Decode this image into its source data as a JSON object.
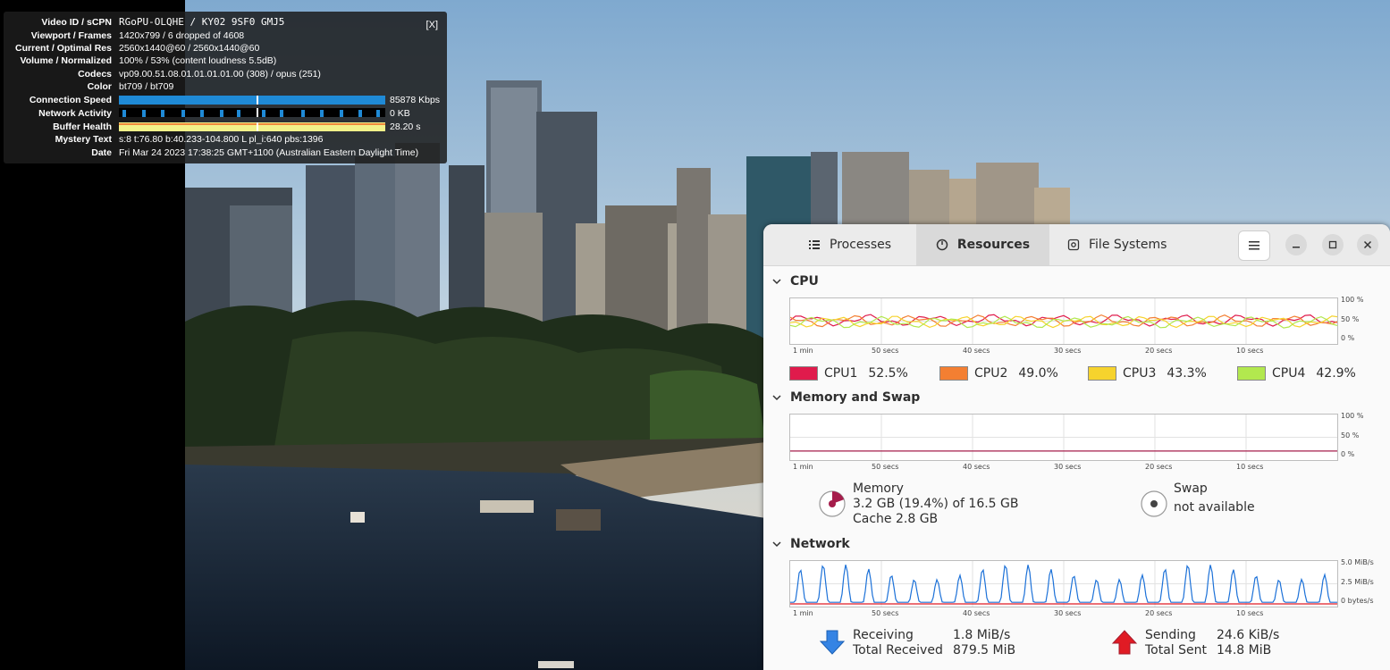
{
  "stats": {
    "close": "[X]",
    "rows": [
      {
        "label": "Video ID / sCPN",
        "value": "RGoPU-OLQHE / KY02 9SF0 GMJ5"
      },
      {
        "label": "Viewport / Frames",
        "value": "1420x799 / 6 dropped of 4608"
      },
      {
        "label": "Current / Optimal Res",
        "value": "2560x1440@60 / 2560x1440@60"
      },
      {
        "label": "Volume / Normalized",
        "value": "100% / 53% (content loudness 5.5dB)"
      },
      {
        "label": "Codecs",
        "value": "vp09.00.51.08.01.01.01.01.00 (308) / opus (251)"
      },
      {
        "label": "Color",
        "value": "bt709 / bt709"
      },
      {
        "label": "Connection Speed",
        "value": "85878 Kbps"
      },
      {
        "label": "Network Activity",
        "value": "0 KB"
      },
      {
        "label": "Buffer Health",
        "value": "28.20 s"
      },
      {
        "label": "Mystery Text",
        "value": "s:8 t:76.80 b:40.233-104.800 L pl_i:640 pbs:1396"
      },
      {
        "label": "Date",
        "value": "Fri Mar 24 2023 17:38:25 GMT+1100 (Australian Eastern Daylight Time)"
      }
    ],
    "colors": {
      "speed": "#1f8ad6",
      "activity_bg": "#000000",
      "buffer": "#f2f28a",
      "buffer_line": "#f08a3c"
    }
  },
  "sysmon": {
    "tabs": [
      {
        "label": "Processes",
        "icon": "list-icon"
      },
      {
        "label": "Resources",
        "icon": "gauge-icon"
      },
      {
        "label": "File Systems",
        "icon": "disk-icon"
      }
    ],
    "active_tab": "Resources",
    "x_axis_labels": [
      "1 min",
      "50 secs",
      "40 secs",
      "30 secs",
      "20 secs",
      "10 secs"
    ],
    "cpu": {
      "title": "CPU",
      "y_labels": [
        "100 %",
        "50 %",
        "0 %"
      ],
      "cores": [
        {
          "name": "CPU1",
          "pct": "52.5%",
          "color": "#e01b4c"
        },
        {
          "name": "CPU2",
          "pct": "49.0%",
          "color": "#f37f32"
        },
        {
          "name": "CPU3",
          "pct": "43.3%",
          "color": "#f6d32d"
        },
        {
          "name": "CPU4",
          "pct": "42.9%",
          "color": "#b2e84e"
        }
      ]
    },
    "memory": {
      "title": "Memory and Swap",
      "y_labels": [
        "100 %",
        "50 %",
        "0 %"
      ],
      "memory_label": "Memory",
      "memory_value": "3.2 GB (19.4%) of 16.5 GB",
      "memory_fraction": 0.194,
      "cache": "Cache 2.8 GB",
      "swap_label": "Swap",
      "swap_value": "not available",
      "color": "#a51d4b"
    },
    "network": {
      "title": "Network",
      "y_labels": [
        "5.0 MiB/s",
        "2.5 MiB/s",
        "0 bytes/s"
      ],
      "receiving_label": "Receiving",
      "receiving_value": "1.8 MiB/s",
      "total_received_label": "Total Received",
      "total_received_value": "879.5 MiB",
      "sending_label": "Sending",
      "sending_value": "24.6 KiB/s",
      "total_sent_label": "Total Sent",
      "total_sent_value": "14.8 MiB",
      "receive_color": "#1c71d8",
      "send_color": "#e01b24"
    }
  }
}
